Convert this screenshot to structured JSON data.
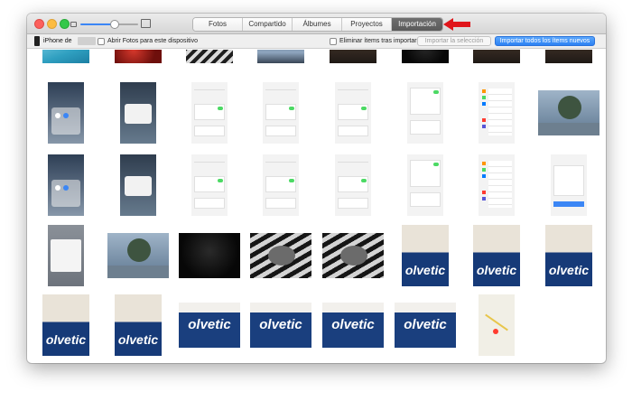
{
  "tabs": [
    {
      "label": "Fotos",
      "active": false
    },
    {
      "label": "Compartido",
      "active": false
    },
    {
      "label": "Álbumes",
      "active": false
    },
    {
      "label": "Proyectos",
      "active": false
    },
    {
      "label": "Importación",
      "active": true
    }
  ],
  "toolbar": {
    "device_name": "iPhone de",
    "open_photos_label": "Abrir Fotos para este dispositivo",
    "delete_after_import_label": "Eliminar ítems tras importar",
    "import_selection_label": "Importar la selección",
    "import_all_label": "Importar todos los ítems nuevos"
  },
  "colors": {
    "accent": "#2d82f4",
    "annotation_arrow": "#e0151b",
    "active_tab": "#5f5f5f"
  },
  "photos": [
    {
      "kind": "water"
    },
    {
      "kind": "red"
    },
    {
      "kind": "zebra"
    },
    {
      "kind": "pool"
    },
    {
      "kind": "dark-people"
    },
    {
      "kind": "dark"
    },
    {
      "kind": "dark-people"
    },
    {
      "kind": "dark-people"
    },
    {
      "kind": "control-center"
    },
    {
      "kind": "alert-screen"
    },
    {
      "kind": "settings-white"
    },
    {
      "kind": "settings-white"
    },
    {
      "kind": "settings-white"
    },
    {
      "kind": "settings-list"
    },
    {
      "kind": "settings-colored"
    },
    {
      "kind": "tree-rain"
    },
    {
      "kind": "control-center"
    },
    {
      "kind": "alert-screen"
    },
    {
      "kind": "settings-white"
    },
    {
      "kind": "settings-white"
    },
    {
      "kind": "settings-white"
    },
    {
      "kind": "settings-list"
    },
    {
      "kind": "settings-colored"
    },
    {
      "kind": "settings-blue"
    },
    {
      "kind": "alert-gray"
    },
    {
      "kind": "tree-rain"
    },
    {
      "kind": "dark"
    },
    {
      "kind": "zebra-cat"
    },
    {
      "kind": "zebra-cat"
    },
    {
      "kind": "cup-blue",
      "text": "olvetic"
    },
    {
      "kind": "cup-blue",
      "text": "olvetic"
    },
    {
      "kind": "cup-blue",
      "text": "olvetic"
    },
    {
      "kind": "cup-blue",
      "text": "olvetic"
    },
    {
      "kind": "cup-blue",
      "text": "olvetic"
    },
    {
      "kind": "bag",
      "text": "olvetic"
    },
    {
      "kind": "bag",
      "text": "olvetic"
    },
    {
      "kind": "bag",
      "text": "olvetic"
    },
    {
      "kind": "bag",
      "text": "olvetic"
    },
    {
      "kind": "map"
    }
  ]
}
